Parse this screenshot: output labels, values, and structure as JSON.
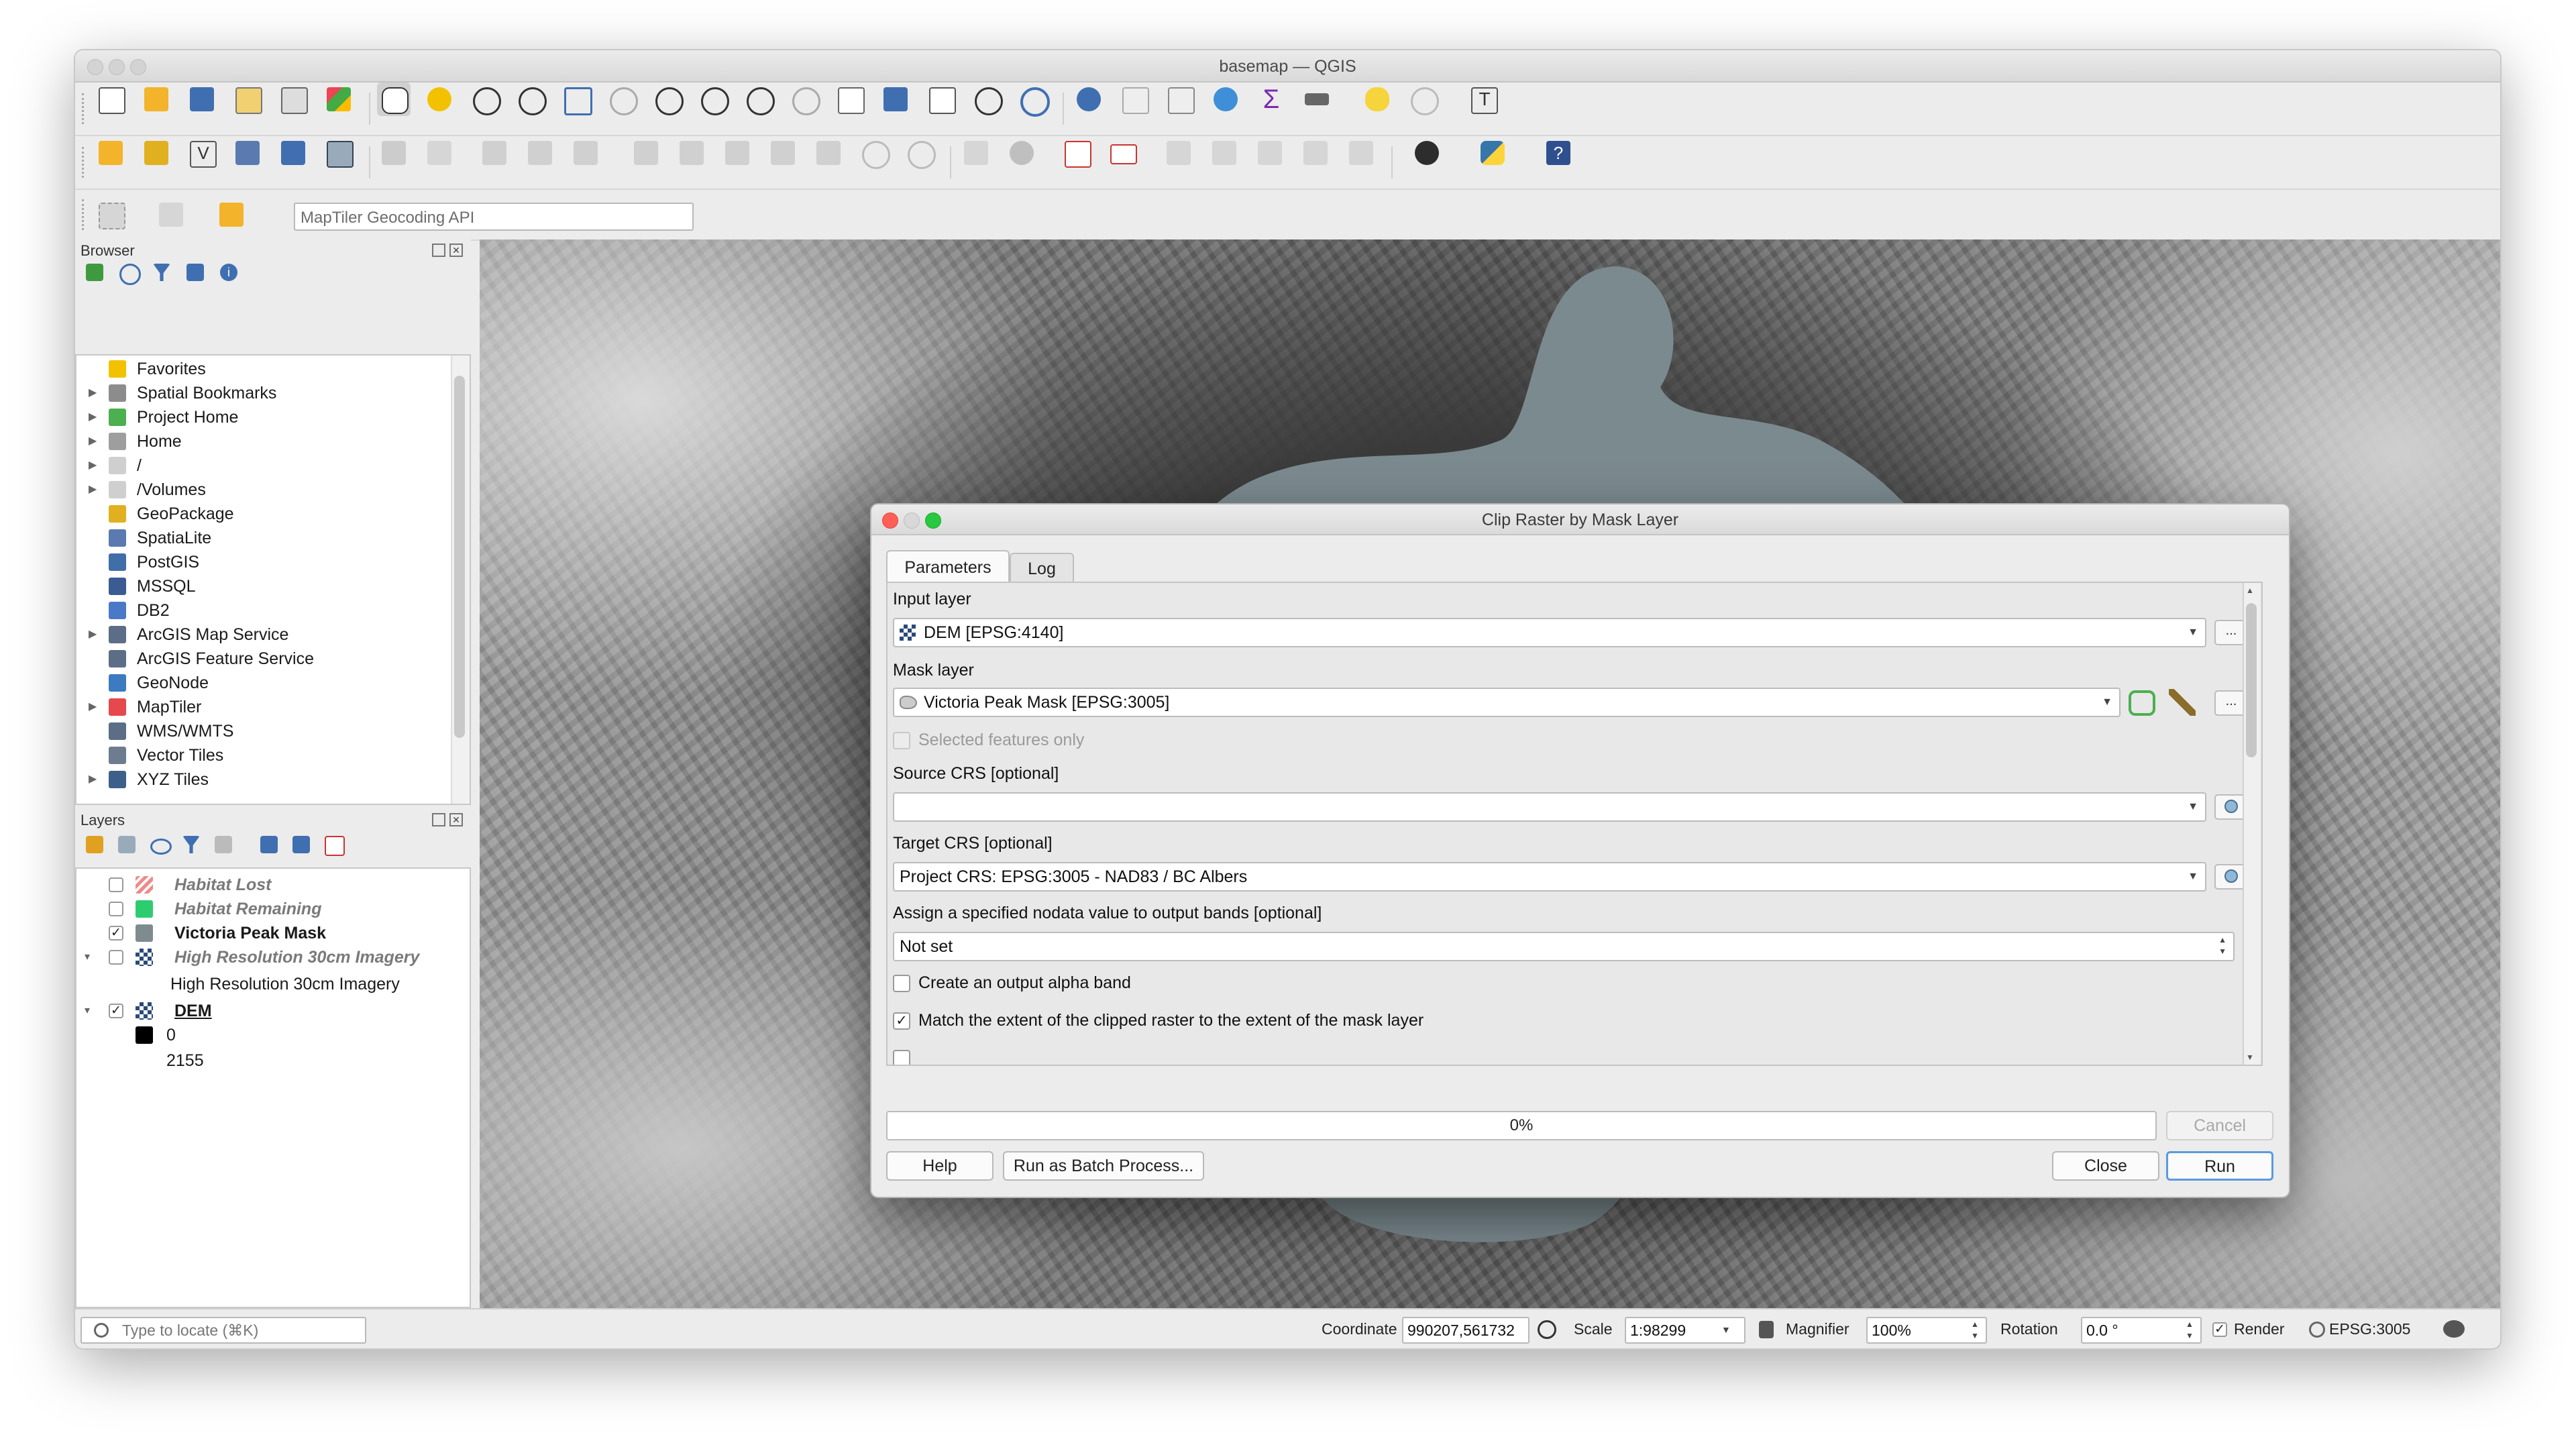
{
  "window": {
    "title": "basemap — QGIS"
  },
  "geocoder": {
    "placeholder": "MapTiler Geocoding API"
  },
  "browser": {
    "title": "Browser",
    "items": [
      {
        "label": "Favorites",
        "icon": "star-icon",
        "color": "#f2c200",
        "expandable": false
      },
      {
        "label": "Spatial Bookmarks",
        "icon": "bookmark-icon",
        "color": "#8c8c8c",
        "expandable": true
      },
      {
        "label": "Project Home",
        "icon": "project-home-icon",
        "color": "#4caf50",
        "expandable": true
      },
      {
        "label": "Home",
        "icon": "home-icon",
        "color": "#9e9e9e",
        "expandable": true
      },
      {
        "label": "/",
        "icon": "folder-icon",
        "color": "#cfcfcf",
        "expandable": true
      },
      {
        "label": "/Volumes",
        "icon": "folder-icon",
        "color": "#cfcfcf",
        "expandable": true
      },
      {
        "label": "GeoPackage",
        "icon": "geopackage-icon",
        "color": "#e0b020",
        "expandable": false
      },
      {
        "label": "SpatiaLite",
        "icon": "spatialite-icon",
        "color": "#5a7ab0",
        "expandable": false
      },
      {
        "label": "PostGIS",
        "icon": "postgis-icon",
        "color": "#3f6ea8",
        "expandable": false
      },
      {
        "label": "MSSQL",
        "icon": "mssql-icon",
        "color": "#3a5c93",
        "expandable": false
      },
      {
        "label": "DB2",
        "icon": "db2-icon",
        "color": "#4b79c8",
        "expandable": false
      },
      {
        "label": "ArcGIS Map Service",
        "icon": "globe-icon",
        "color": "#5c6d86",
        "expandable": true
      },
      {
        "label": "ArcGIS Feature Service",
        "icon": "globe-icon",
        "color": "#5c6d86",
        "expandable": false
      },
      {
        "label": "GeoNode",
        "icon": "geonode-icon",
        "color": "#3c7bc0",
        "expandable": false
      },
      {
        "label": "MapTiler",
        "icon": "maptiler-icon",
        "color": "#e5484d",
        "expandable": true
      },
      {
        "label": "WMS/WMTS",
        "icon": "globe-icon",
        "color": "#5c6d86",
        "expandable": false
      },
      {
        "label": "Vector Tiles",
        "icon": "vector-tiles-icon",
        "color": "#6d7d8f",
        "expandable": false
      },
      {
        "label": "XYZ Tiles",
        "icon": "xyz-tiles-icon",
        "color": "#3e5f8a",
        "expandable": true
      }
    ]
  },
  "layers": {
    "title": "Layers",
    "items": [
      {
        "label": "Habitat Lost",
        "checked": false,
        "style": "italic-bold-grey",
        "icon": "hatched-fill-icon",
        "color": "#f08a8a",
        "expander": ""
      },
      {
        "label": "Habitat Remaining",
        "checked": false,
        "style": "italic-bold-grey",
        "icon": "green-fill-icon",
        "color": "#2ecc71",
        "expander": ""
      },
      {
        "label": "Victoria Peak Mask",
        "checked": true,
        "style": "bold",
        "icon": "grey-fill-icon",
        "color": "#7e8c90",
        "expander": ""
      },
      {
        "label": "High Resolution 30cm Imagery",
        "checked": false,
        "style": "italic-bold-grey",
        "icon": "raster-icon",
        "color": "#2a4a78",
        "expander": "▾"
      },
      {
        "label": "High Resolution 30cm Imagery",
        "checked": null,
        "style": "child",
        "icon": "",
        "color": "",
        "expander": ""
      },
      {
        "label": "DEM",
        "checked": true,
        "style": "bold-underline",
        "icon": "raster-icon",
        "color": "#2a4a78",
        "expander": "▾"
      },
      {
        "label": "0",
        "checked": null,
        "style": "legend",
        "icon": "black-swatch-icon",
        "color": "#000000",
        "expander": ""
      },
      {
        "label": "2155",
        "checked": null,
        "style": "legend",
        "icon": "",
        "color": "",
        "expander": ""
      }
    ]
  },
  "dialog": {
    "title": "Clip Raster by Mask Layer",
    "tabs": [
      "Parameters",
      "Log"
    ],
    "input_layer_label": "Input layer",
    "input_layer_value": "DEM [EPSG:4140]",
    "mask_layer_label": "Mask layer",
    "mask_layer_value": "Victoria Peak Mask [EPSG:3005]",
    "selected_only_label": "Selected features only",
    "source_crs_label": "Source CRS [optional]",
    "source_crs_value": "",
    "target_crs_label": "Target CRS [optional]",
    "target_crs_value": "Project CRS: EPSG:3005 - NAD83 / BC Albers",
    "nodata_label": "Assign a specified nodata value to output bands [optional]",
    "nodata_value": "Not set",
    "alpha_label": "Create an output alpha band",
    "alpha_checked": false,
    "match_extent_label": "Match the extent of the clipped raster to the extent of the mask layer",
    "match_extent_checked": true,
    "browse_label": "...",
    "progress_text": "0%",
    "progress_fraction": 0,
    "cancel_label": "Cancel",
    "help_label": "Help",
    "batch_label": "Run as Batch Process...",
    "close_label": "Close",
    "run_label": "Run"
  },
  "statusbar": {
    "locate_placeholder": "Type to locate (⌘K)",
    "coordinate_label": "Coordinate",
    "coordinate_value": "990207,561732",
    "scale_label": "Scale",
    "scale_value": "1:98299",
    "magnifier_label": "Magnifier",
    "magnifier_value": "100%",
    "rotation_label": "Rotation",
    "rotation_value": "0.0 °",
    "render_label": "Render",
    "render_checked": true,
    "crs_label": "EPSG:3005"
  },
  "colors": {
    "mask_fill": "#7b8a8f",
    "run_button_border": "#5a9bdc",
    "accent_green": "#4caf50"
  }
}
